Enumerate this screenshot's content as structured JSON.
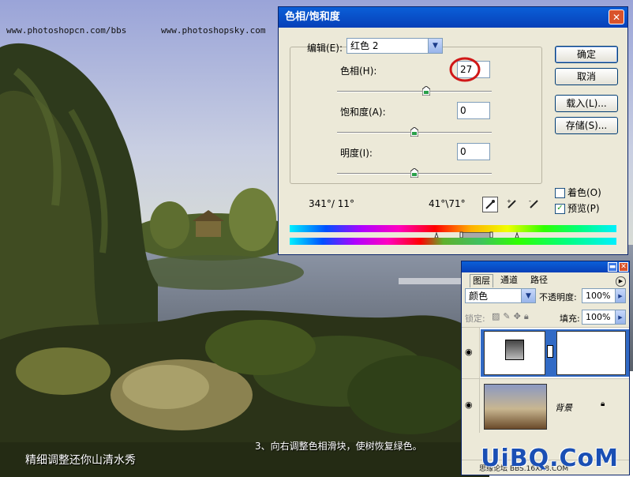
{
  "watermark": {
    "left": "www.photoshopcn.com/bbs",
    "right": "www.photoshopsky.com"
  },
  "captions": {
    "title": "精细调整还你山清水秀",
    "step": "3、向右调整色相滑块，使树恢复绿色。"
  },
  "logo": {
    "text": "UiBQ.CoM",
    "sub": "思缘论坛 BBS.16XX8.COM"
  },
  "dialog": {
    "title": "色相/饱和度",
    "close_glyph": "✕",
    "edit_label": "编辑(E):",
    "edit_value": "红色 2",
    "hue_label": "色相(H):",
    "hue_value": "27",
    "saturation_label": "饱和度(A):",
    "saturation_value": "0",
    "lightness_label": "明度(I):",
    "lightness_value": "0",
    "range_left": "341°/ 11°",
    "range_right": "41°\\71°",
    "ok": "确定",
    "cancel": "取消",
    "load": "载入(L)...",
    "save": "存储(S)...",
    "colorize": "着色(O)",
    "colorize_checked": false,
    "preview": "预览(P)",
    "preview_checked": true,
    "check_glyph": "✓",
    "hue_slider_fraction": 0.575,
    "saturation_slider_fraction": 0.5,
    "lightness_slider_fraction": 0.5,
    "highlight_color": "#d01818"
  },
  "layers": {
    "tabs": [
      "图层",
      "通道",
      "路径"
    ],
    "blend_mode": "颜色",
    "opacity_label": "不透明度:",
    "opacity_value": "100%",
    "lock_label": "锁定:",
    "fill_label": "填充:",
    "fill_value": "100%",
    "bg_layer_name": "背景",
    "bottom_text": "思缘论坛 BBS.16XX8.COM"
  }
}
